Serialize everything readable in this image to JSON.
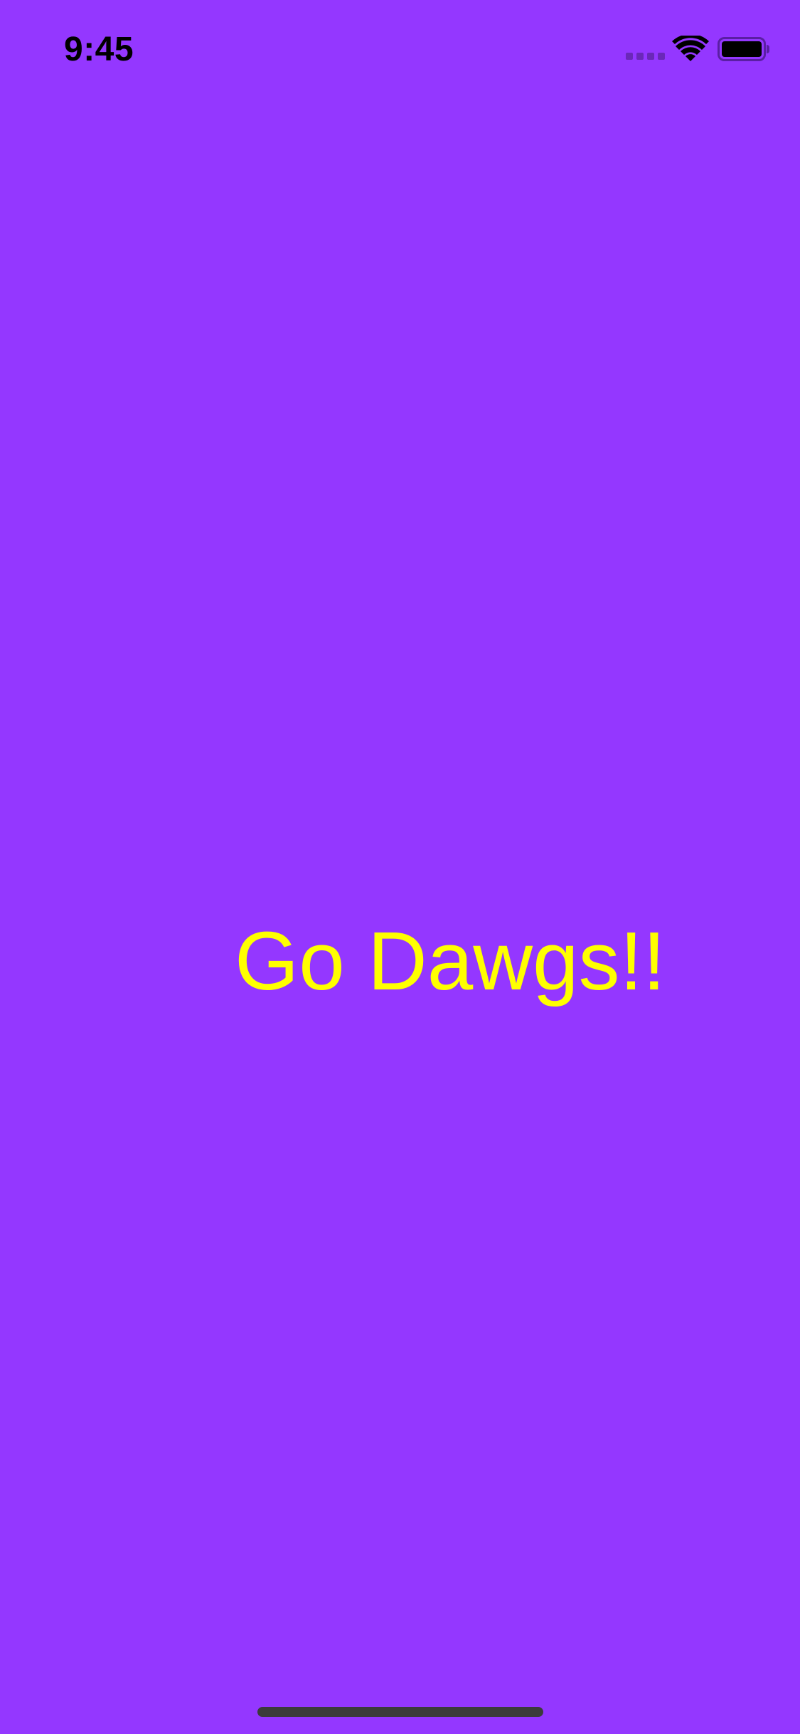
{
  "status_bar": {
    "time": "9:45",
    "icons": {
      "signal": "cellular-signal-icon",
      "wifi": "wifi-icon",
      "battery": "battery-icon"
    }
  },
  "main": {
    "label": "Go Dawgs!!"
  },
  "colors": {
    "background": "#9437ff",
    "label": "#ffff00",
    "status_text": "#000000",
    "home_indicator": "#3b3b3b"
  }
}
